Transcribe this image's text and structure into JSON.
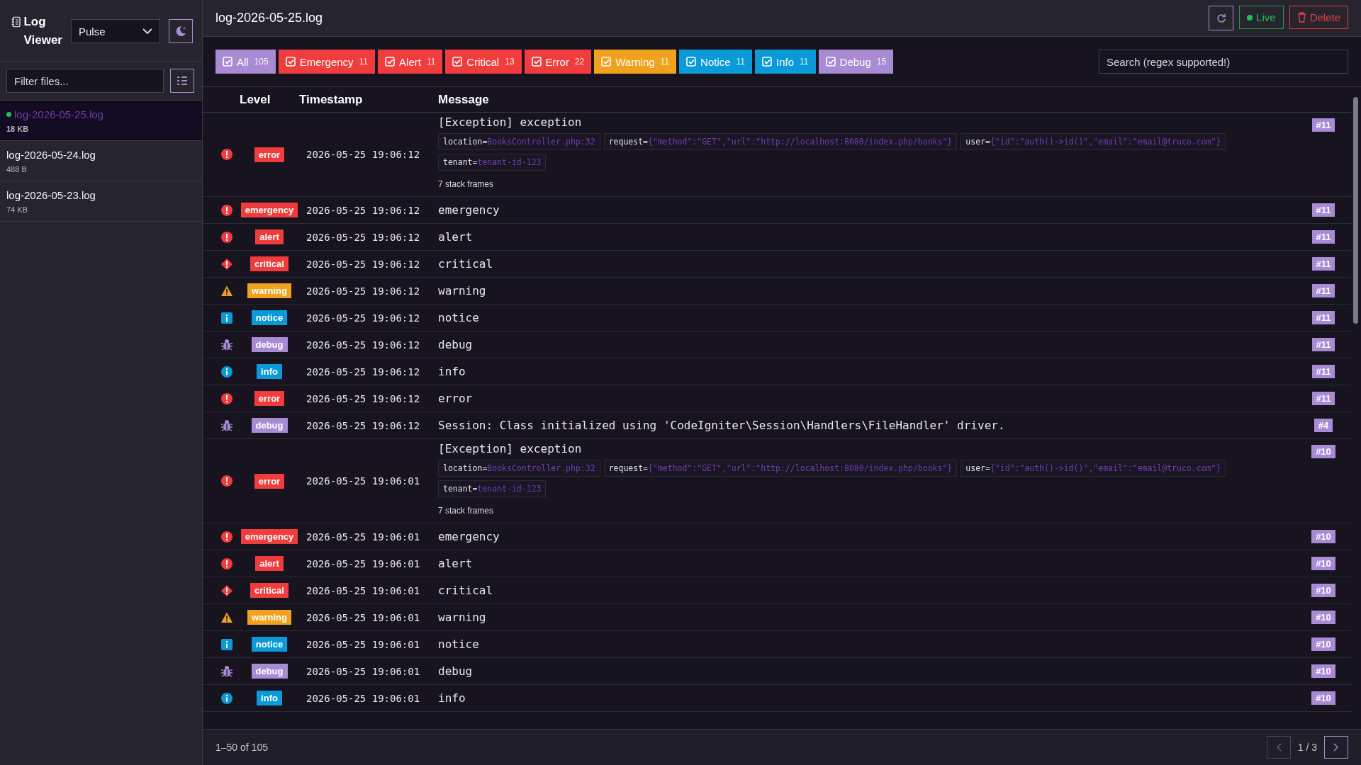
{
  "sidebar": {
    "brand": "Log\nViewer",
    "theme_select": "Pulse",
    "filter": {
      "placeholder": "Filter files..."
    },
    "files": [
      {
        "name": "log-2026-05-25.log",
        "size": "18 KB",
        "selected": true,
        "live": true
      },
      {
        "name": "log-2026-05-24.log",
        "size": "488 B",
        "selected": false,
        "live": false
      },
      {
        "name": "log-2026-05-23.log",
        "size": "74 KB",
        "selected": false,
        "live": false
      }
    ]
  },
  "header": {
    "title": "log-2026-05-25.log",
    "live_button": "Live",
    "delete_button": "Delete"
  },
  "filters": [
    {
      "label": "All",
      "count": "105",
      "kind": "all",
      "checked": true
    },
    {
      "label": "Emergency",
      "count": "11",
      "kind": "emergency",
      "checked": true
    },
    {
      "label": "Alert",
      "count": "11",
      "kind": "alert",
      "checked": true
    },
    {
      "label": "Critical",
      "count": "13",
      "kind": "critical",
      "checked": true
    },
    {
      "label": "Error",
      "count": "22",
      "kind": "error",
      "checked": true
    },
    {
      "label": "Warning",
      "count": "11",
      "kind": "warning",
      "checked": true
    },
    {
      "label": "Notice",
      "count": "11",
      "kind": "notice",
      "checked": true
    },
    {
      "label": "Info",
      "count": "11",
      "kind": "info",
      "checked": true
    },
    {
      "label": "Debug",
      "count": "15",
      "kind": "debug",
      "checked": true
    }
  ],
  "search": {
    "placeholder": "Search (regex supported!)"
  },
  "table": {
    "columns": [
      "Level",
      "Timestamp",
      "Message"
    ],
    "rows": [
      {
        "level": "error",
        "time": "2026-05-25 19:06:12",
        "message": "[Exception] exception",
        "context": [
          {
            "key": "location=",
            "value": "BooksController.php:32"
          },
          {
            "key": "request=",
            "value": "{\"method\":\"GET\",\"url\":\"http://localhost:8080/index.php/books\"}"
          },
          {
            "key": "user=",
            "value": "{\"id\":\"auth()->id()\",\"email\":\"email@truco.com\"}"
          },
          {
            "key": "tenant=",
            "value": "tenant-id-123"
          }
        ],
        "stack": "7 stack frames",
        "tag": "#11"
      },
      {
        "level": "emergency",
        "time": "2026-05-25 19:06:12",
        "message": "emergency",
        "tag": "#11"
      },
      {
        "level": "alert",
        "time": "2026-05-25 19:06:12",
        "message": "alert",
        "tag": "#11"
      },
      {
        "level": "critical",
        "time": "2026-05-25 19:06:12",
        "message": "critical",
        "tag": "#11"
      },
      {
        "level": "warning",
        "time": "2026-05-25 19:06:12",
        "message": "warning",
        "tag": "#11"
      },
      {
        "level": "notice",
        "time": "2026-05-25 19:06:12",
        "message": "notice",
        "tag": "#11"
      },
      {
        "level": "debug",
        "time": "2026-05-25 19:06:12",
        "message": "debug",
        "tag": "#11"
      },
      {
        "level": "info",
        "time": "2026-05-25 19:06:12",
        "message": "info",
        "tag": "#11"
      },
      {
        "level": "error",
        "time": "2026-05-25 19:06:12",
        "message": "error",
        "tag": "#11"
      },
      {
        "level": "debug",
        "time": "2026-05-25 19:06:12",
        "message": "Session: Class initialized using 'CodeIgniter\\Session\\Handlers\\FileHandler' driver.",
        "tag": "#4"
      },
      {
        "level": "error",
        "time": "2026-05-25 19:06:01",
        "message": "[Exception] exception",
        "context": [
          {
            "key": "location=",
            "value": "BooksController.php:32"
          },
          {
            "key": "request=",
            "value": "{\"method\":\"GET\",\"url\":\"http://localhost:8080/index.php/books\"}"
          },
          {
            "key": "user=",
            "value": "{\"id\":\"auth()->id()\",\"email\":\"email@truco.com\"}"
          },
          {
            "key": "tenant=",
            "value": "tenant-id-123"
          }
        ],
        "stack": "7 stack frames",
        "tag": "#10"
      },
      {
        "level": "emergency",
        "time": "2026-05-25 19:06:01",
        "message": "emergency",
        "tag": "#10"
      },
      {
        "level": "alert",
        "time": "2026-05-25 19:06:01",
        "message": "alert",
        "tag": "#10"
      },
      {
        "level": "critical",
        "time": "2026-05-25 19:06:01",
        "message": "critical",
        "tag": "#10"
      },
      {
        "level": "warning",
        "time": "2026-05-25 19:06:01",
        "message": "warning",
        "tag": "#10"
      },
      {
        "level": "notice",
        "time": "2026-05-25 19:06:01",
        "message": "notice",
        "tag": "#10"
      },
      {
        "level": "debug",
        "time": "2026-05-25 19:06:01",
        "message": "debug",
        "tag": "#10"
      },
      {
        "level": "info",
        "time": "2026-05-25 19:06:01",
        "message": "info",
        "tag": "#10"
      }
    ]
  },
  "pagination": {
    "range": "1–50 of 105",
    "page": "1 / 3",
    "prev_disabled": true,
    "next_disabled": false
  }
}
